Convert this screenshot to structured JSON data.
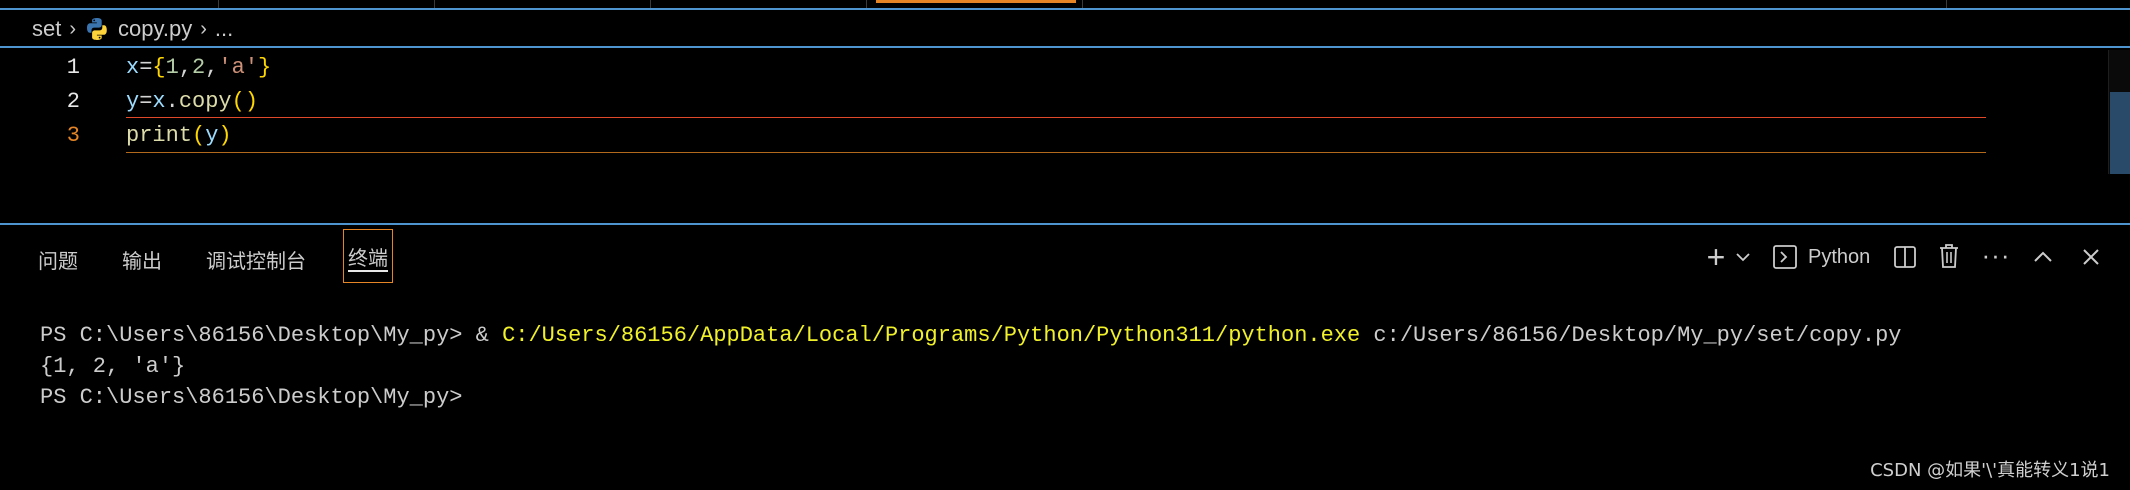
{
  "breadcrumb": {
    "folder": "set",
    "file": "copy.py",
    "more": "..."
  },
  "editor": {
    "lines": [
      {
        "number": "1",
        "tokens": [
          [
            "var",
            "x"
          ],
          [
            "op",
            "="
          ],
          [
            "br",
            "{"
          ],
          [
            "num",
            "1"
          ],
          [
            "op",
            ","
          ],
          [
            "num",
            "2"
          ],
          [
            "op",
            ","
          ],
          [
            "str",
            "'a'"
          ],
          [
            "br",
            "}"
          ]
        ]
      },
      {
        "number": "2",
        "tokens": [
          [
            "var",
            "y"
          ],
          [
            "op",
            "="
          ],
          [
            "var",
            "x"
          ],
          [
            "op",
            "."
          ],
          [
            "fn",
            "copy"
          ],
          [
            "br",
            "()"
          ]
        ]
      },
      {
        "number": "3",
        "tokens": [
          [
            "fn",
            "print"
          ],
          [
            "br",
            "("
          ],
          [
            "var",
            "y"
          ],
          [
            "br",
            ")"
          ]
        ]
      }
    ],
    "current_line": "3"
  },
  "panel": {
    "tabs": [
      "问题",
      "输出",
      "调试控制台",
      "终端"
    ],
    "active_tab": "终端",
    "profile_label": "Python"
  },
  "terminal": {
    "line1_prompt": "PS C:\\Users\\86156\\Desktop\\My_py> & ",
    "line1_exe": "C:/Users/86156/AppData/Local/Programs/Python/Python311/python.exe",
    "line1_arg": " c:/Users/86156/Desktop/My_py/set/copy.py",
    "line2": "{1, 2, 'a'}",
    "line3": "PS C:\\Users\\86156\\Desktop\\My_py>"
  },
  "watermark": "CSDN @如果'\\'真能转义1说1",
  "colors": {
    "accent_blue": "#4e94ce",
    "accent_orange": "#e58525",
    "terminal_path_yellow": "#f1f12a"
  },
  "icons": [
    "python-file-icon",
    "plus-icon",
    "chevron-down-icon",
    "terminal-icon",
    "split-icon",
    "trash-icon",
    "more-icon",
    "chevron-up-icon",
    "close-icon"
  ]
}
